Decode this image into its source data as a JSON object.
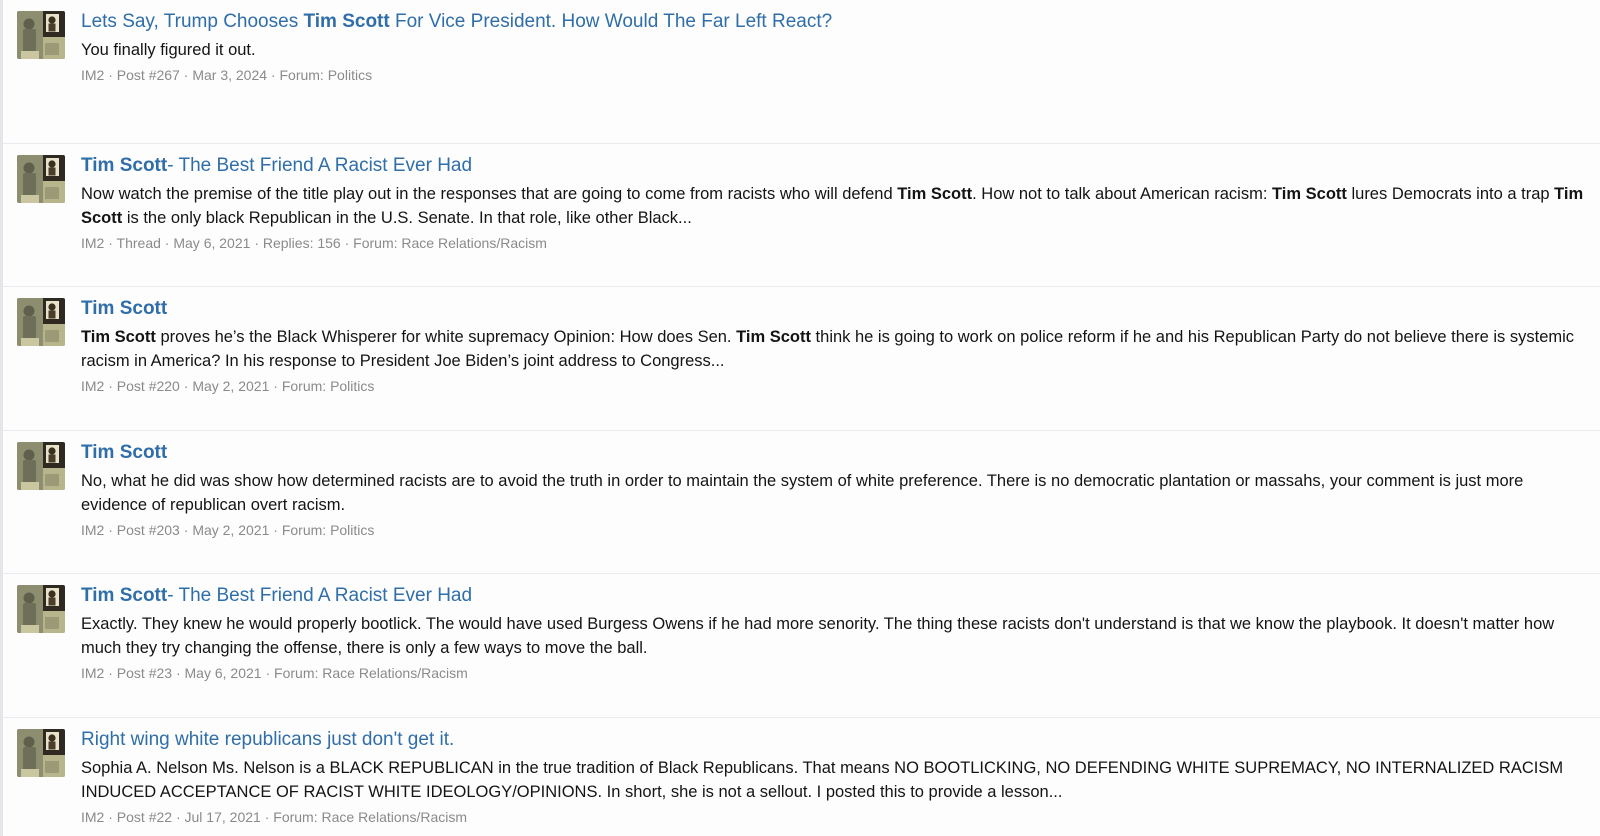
{
  "results": [
    {
      "title": [
        {
          "t": "Lets Say, Trump Chooses ",
          "b": false
        },
        {
          "t": "Tim Scott",
          "b": true
        },
        {
          "t": " For Vice President. How Would The Far Left React?",
          "b": false
        }
      ],
      "snippet": [
        {
          "t": "You finally figured it out.",
          "b": false
        }
      ],
      "author": "IM2",
      "type": "Post #267",
      "date": "Mar 3, 2024",
      "replies": "",
      "forum_prefix": "Forum:",
      "forum": "Politics"
    },
    {
      "title": [
        {
          "t": "Tim Scott",
          "b": true
        },
        {
          "t": "- The Best Friend A Racist Ever Had",
          "b": false
        }
      ],
      "snippet": [
        {
          "t": "Now watch the premise of the title play out in the responses that are going to come from racists who will defend ",
          "b": false
        },
        {
          "t": "Tim Scott",
          "b": true
        },
        {
          "t": ". How not to talk about American racism: ",
          "b": false
        },
        {
          "t": "Tim Scott",
          "b": true
        },
        {
          "t": " lures Democrats into a trap ",
          "b": false
        },
        {
          "t": "Tim Scott",
          "b": true
        },
        {
          "t": " is the only black Republican in the U.S. Senate. In that role, like other Black...",
          "b": false
        }
      ],
      "author": "IM2",
      "type": "Thread",
      "date": "May 6, 2021",
      "replies": "Replies: 156",
      "forum_prefix": "Forum:",
      "forum": "Race Relations/Racism"
    },
    {
      "title": [
        {
          "t": "Tim Scott",
          "b": true
        }
      ],
      "snippet": [
        {
          "t": "Tim Scott",
          "b": true
        },
        {
          "t": " proves he’s the Black Whisperer for white supremacy Opinion: How does Sen. ",
          "b": false
        },
        {
          "t": "Tim Scott",
          "b": true
        },
        {
          "t": " think he is going to work on police reform if he and his Republican Party do not believe there is systemic racism in America? In his response to President Joe Biden’s joint address to Congress...",
          "b": false
        }
      ],
      "author": "IM2",
      "type": "Post #220",
      "date": "May 2, 2021",
      "replies": "",
      "forum_prefix": "Forum:",
      "forum": "Politics"
    },
    {
      "title": [
        {
          "t": "Tim Scott",
          "b": true
        }
      ],
      "snippet": [
        {
          "t": "No, what he did was show how determined racists are to avoid the truth in order to maintain the system of white preference. There is no democratic plantation or massahs, your comment is just more evidence of republican overt racism.",
          "b": false
        }
      ],
      "author": "IM2",
      "type": "Post #203",
      "date": "May 2, 2021",
      "replies": "",
      "forum_prefix": "Forum:",
      "forum": "Politics"
    },
    {
      "title": [
        {
          "t": "Tim Scott",
          "b": true
        },
        {
          "t": "- The Best Friend A Racist Ever Had",
          "b": false
        }
      ],
      "snippet": [
        {
          "t": "Exactly. They knew he would properly bootlick. The would have used Burgess Owens if he had more senority. The thing these racists don't understand is that we know the playbook. It doesn't matter how much they try changing the offense, there is only a few ways to move the ball.",
          "b": false
        }
      ],
      "author": "IM2",
      "type": "Post #23",
      "date": "May 6, 2021",
      "replies": "",
      "forum_prefix": "Forum:",
      "forum": "Race Relations/Racism"
    },
    {
      "title": [
        {
          "t": "Right wing white republicans just don't get it.",
          "b": false
        }
      ],
      "snippet": [
        {
          "t": "Sophia A. Nelson Ms. Nelson is a BLACK REPUBLICAN in the true tradition of Black Republicans. That means NO BOOTLICKING, NO DEFENDING WHITE SUPREMACY, NO INTERNALIZED RACISM INDUCED ACCEPTANCE OF RACIST WHITE IDEOLOGY/OPINIONS. In short, she is not a sellout. I posted this to provide a lesson...",
          "b": false
        }
      ],
      "author": "IM2",
      "type": "Post #22",
      "date": "Jul 17, 2021",
      "replies": "",
      "forum_prefix": "Forum:",
      "forum": "Race Relations/Racism"
    }
  ],
  "colors": {
    "link": "#2f6ea8",
    "text": "#141414",
    "meta": "#8a8a8a",
    "divider": "#e8eaee"
  },
  "icons": {
    "avatar": "user-avatar-icon",
    "separator": "·"
  }
}
